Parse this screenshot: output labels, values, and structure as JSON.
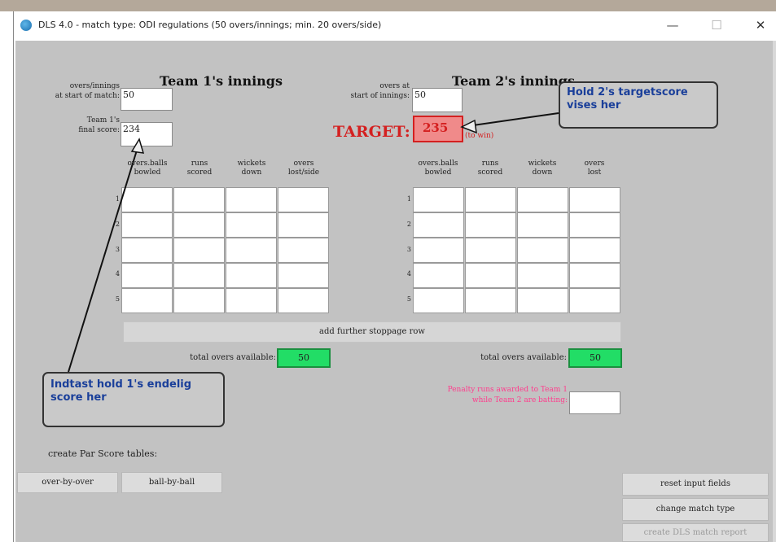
{
  "window": {
    "title": "DLS 4.0 - match type: ODI regulations (50 overs/innings; min. 20 overs/side)",
    "minimize_glyph": "—",
    "maximize_glyph": "☐",
    "close_glyph": "✕"
  },
  "team1": {
    "heading": "Team 1's innings",
    "overs_label_1": "overs/innings",
    "overs_label_2": "at start of match:",
    "overs_value": "50",
    "final_label_1": "Team 1's",
    "final_label_2": "final score:",
    "final_value": "234",
    "columns": [
      {
        "l1": "overs.balls",
        "l2": "bowled"
      },
      {
        "l1": "runs",
        "l2": "scored"
      },
      {
        "l1": "wickets",
        "l2": "down"
      },
      {
        "l1": "overs",
        "l2": "lost/side"
      }
    ],
    "row_numbers": [
      "1",
      "2",
      "3",
      "4",
      "5"
    ],
    "total_label": "total overs available:",
    "total_value": "50"
  },
  "team2": {
    "heading": "Team 2's innings",
    "overs_label_1": "overs at",
    "overs_label_2": "start of innings:",
    "overs_value": "50",
    "target_label": "TARGET:",
    "target_value": "235",
    "target_note": "(to win)",
    "columns": [
      {
        "l1": "overs.balls",
        "l2": "bowled"
      },
      {
        "l1": "runs",
        "l2": "scored"
      },
      {
        "l1": "wickets",
        "l2": "down"
      },
      {
        "l1": "overs",
        "l2": "lost"
      }
    ],
    "row_numbers": [
      "1",
      "2",
      "3",
      "4",
      "5"
    ],
    "total_label": "total overs available:",
    "total_value": "50",
    "penalty_label_1": "Penalty runs awarded to Team 1",
    "penalty_label_2": "while Team 2 are batting:",
    "penalty_value": ""
  },
  "add_stoppage_label": "add further stoppage row",
  "par_score": {
    "label": "create Par Score tables:",
    "over_by_over": "over-by-over",
    "ball_by_ball": "ball-by-ball"
  },
  "actions": {
    "reset": "reset input fields",
    "change": "change match type",
    "report": "create DLS match report"
  },
  "callouts": {
    "target": "Hold 2's targetscore vises her",
    "final": "Indtast hold 1's endelig score her"
  },
  "colors": {
    "client_bg": "#c2c2c2",
    "target_red": "#d42020",
    "green": "#22dd66",
    "callout_text": "#1a3f9a",
    "penalty_pink": "#ff3c8c"
  }
}
